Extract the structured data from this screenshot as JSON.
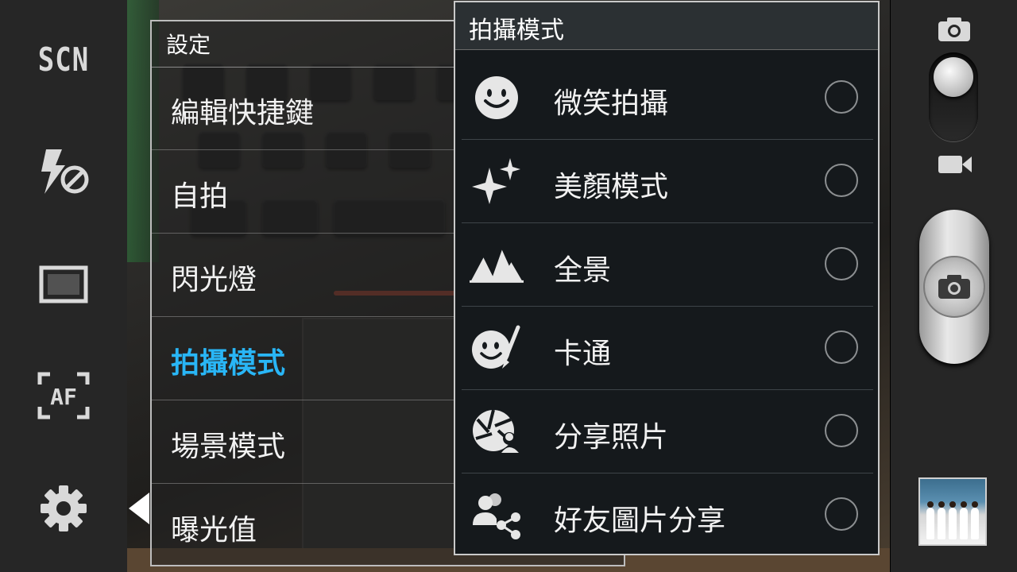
{
  "left_toolbar": {
    "scene_label": "SCN",
    "icons": [
      "scene-mode-icon",
      "flash-off-icon",
      "aspect-ratio-icon",
      "autofocus-icon",
      "gear-icon"
    ]
  },
  "settings": {
    "title": "設定",
    "items": [
      {
        "label": "編輯快捷鍵",
        "active": false
      },
      {
        "label": "自拍",
        "active": false
      },
      {
        "label": "閃光燈",
        "active": false
      },
      {
        "label": "拍攝模式",
        "active": true
      },
      {
        "label": "場景模式",
        "active": false
      },
      {
        "label": "曝光值",
        "active": false
      }
    ]
  },
  "shooting_mode": {
    "title": "拍攝模式",
    "options": [
      {
        "label": "微笑拍攝",
        "icon": "smile-icon"
      },
      {
        "label": "美顏模式",
        "icon": "sparkle-icon"
      },
      {
        "label": "全景",
        "icon": "mountain-icon"
      },
      {
        "label": "卡通",
        "icon": "cartoon-face-icon"
      },
      {
        "label": "分享照片",
        "icon": "share-shot-icon"
      },
      {
        "label": "好友圖片分享",
        "icon": "buddy-share-icon"
      }
    ]
  },
  "right_bar": {
    "mode": "camera",
    "icons": [
      "camera-icon",
      "video-camera-icon",
      "shutter-camera-icon"
    ]
  },
  "colors": {
    "accent": "#29b6f6",
    "toolbar_bg": "#262626",
    "popup_bg": "#15191c"
  }
}
